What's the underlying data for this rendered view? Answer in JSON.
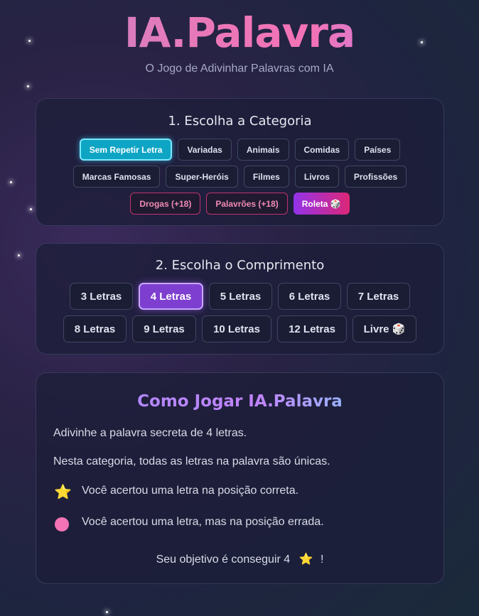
{
  "header": {
    "logo": "IA.Palavra",
    "subtitle": "O Jogo de Adivinhar Palavras com IA"
  },
  "category": {
    "title": "1. Escolha a Categoria",
    "selected": "Sem Repetir Letra",
    "rows": [
      [
        "Sem Repetir Letra",
        "Variadas",
        "Animais",
        "Comidas",
        "Países"
      ],
      [
        "Marcas Famosas",
        "Super-Heróis",
        "Filmes",
        "Livros",
        "Profissões"
      ],
      [
        "Drogas (+18)",
        "Palavrões (+18)",
        "Roleta 🎲"
      ]
    ]
  },
  "length": {
    "title": "2. Escolha o Comprimento",
    "selected": "4 Letras",
    "rows": [
      [
        "3 Letras",
        "4 Letras",
        "5 Letras",
        "6 Letras",
        "7 Letras"
      ],
      [
        "8 Letras",
        "9 Letras",
        "10 Letras",
        "12 Letras",
        "Livre 🎲"
      ]
    ]
  },
  "how_to_play": {
    "title": "Como Jogar IA.Palavra",
    "line1": "Adivinhe a palavra secreta de 4 letras.",
    "line2": "Nesta categoria, todas as letras na palavra são únicas.",
    "star_icon": "⭐",
    "star_text": "Você acertou uma letra na posição correta.",
    "dot_text": "Você acertou uma letra, mas na posição errada.",
    "goal_prefix": "Seu objetivo é conseguir 4",
    "goal_suffix": "!"
  },
  "colors": {
    "active_category": "#0ea5c4",
    "active_length": "#7e3fd0",
    "adult_border": "#c0336e",
    "wrong_position_dot": "#f472b6"
  }
}
